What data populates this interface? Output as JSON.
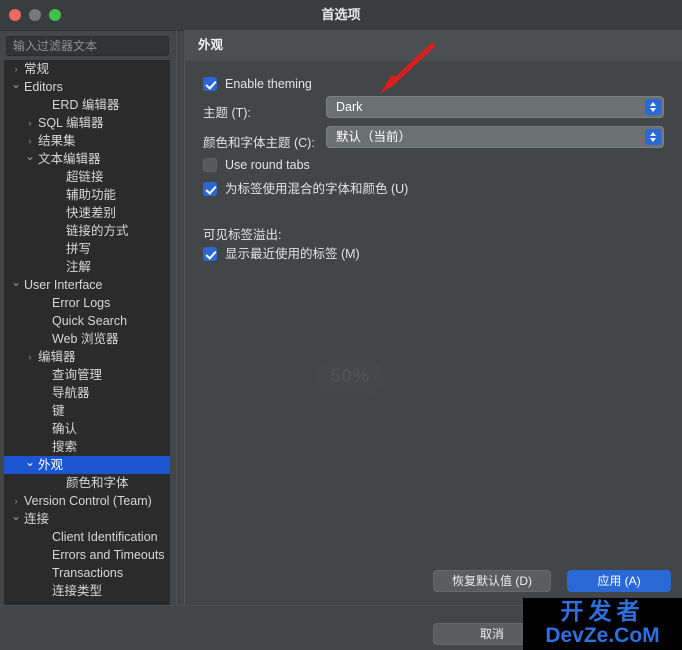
{
  "window": {
    "title": "首选项",
    "traffic_lights": [
      "close-red",
      "minimize-amber",
      "zoom-green"
    ]
  },
  "sidebar": {
    "filter": {
      "value": "",
      "placeholder": "输入过滤器文本"
    },
    "items": [
      {
        "label": "常规",
        "indent": 0,
        "arrow": "collapsed",
        "selected": false
      },
      {
        "label": "Editors",
        "indent": 0,
        "arrow": "expanded",
        "selected": false
      },
      {
        "label": "ERD 编辑器",
        "indent": 2,
        "arrow": "none",
        "selected": false
      },
      {
        "label": "SQL 编辑器",
        "indent": 1,
        "arrow": "collapsed",
        "selected": false
      },
      {
        "label": "结果集",
        "indent": 1,
        "arrow": "collapsed",
        "selected": false
      },
      {
        "label": "文本编辑器",
        "indent": 1,
        "arrow": "expanded",
        "selected": false
      },
      {
        "label": "超链接",
        "indent": 3,
        "arrow": "none",
        "selected": false
      },
      {
        "label": "辅助功能",
        "indent": 3,
        "arrow": "none",
        "selected": false
      },
      {
        "label": "快速差别",
        "indent": 3,
        "arrow": "none",
        "selected": false
      },
      {
        "label": "链接的方式",
        "indent": 3,
        "arrow": "none",
        "selected": false
      },
      {
        "label": "拼写",
        "indent": 3,
        "arrow": "none",
        "selected": false
      },
      {
        "label": "注解",
        "indent": 3,
        "arrow": "none",
        "selected": false
      },
      {
        "label": "User Interface",
        "indent": 0,
        "arrow": "expanded",
        "selected": false
      },
      {
        "label": "Error Logs",
        "indent": 2,
        "arrow": "none",
        "selected": false
      },
      {
        "label": "Quick Search",
        "indent": 2,
        "arrow": "none",
        "selected": false
      },
      {
        "label": "Web 浏览器",
        "indent": 2,
        "arrow": "none",
        "selected": false
      },
      {
        "label": "编辑器",
        "indent": 1,
        "arrow": "collapsed",
        "selected": false
      },
      {
        "label": "查询管理",
        "indent": 2,
        "arrow": "none",
        "selected": false
      },
      {
        "label": "导航器",
        "indent": 2,
        "arrow": "none",
        "selected": false
      },
      {
        "label": "键",
        "indent": 2,
        "arrow": "none",
        "selected": false
      },
      {
        "label": "确认",
        "indent": 2,
        "arrow": "none",
        "selected": false
      },
      {
        "label": "搜索",
        "indent": 2,
        "arrow": "none",
        "selected": false
      },
      {
        "label": "外观",
        "indent": 1,
        "arrow": "expanded",
        "selected": true
      },
      {
        "label": "颜色和字体",
        "indent": 3,
        "arrow": "none",
        "selected": false
      },
      {
        "label": "Version Control (Team)",
        "indent": 0,
        "arrow": "collapsed",
        "selected": false
      },
      {
        "label": "连接",
        "indent": 0,
        "arrow": "expanded",
        "selected": false
      },
      {
        "label": "Client Identification",
        "indent": 2,
        "arrow": "none",
        "selected": false
      },
      {
        "label": "Errors and Timeouts",
        "indent": 2,
        "arrow": "none",
        "selected": false
      },
      {
        "label": "Transactions",
        "indent": 2,
        "arrow": "none",
        "selected": false
      },
      {
        "label": "连接类型",
        "indent": 2,
        "arrow": "none",
        "selected": false
      }
    ]
  },
  "panel": {
    "title": "外观",
    "toolbar": {
      "back_icon": "arrow-left-icon",
      "back_caret": "▾",
      "forward_icon": "arrow-right-icon",
      "forward_caret": "▾",
      "menu_icon": "kebab-menu-icon"
    },
    "enable_theming": {
      "label": "Enable theming",
      "checked": true
    },
    "theme": {
      "label": "主题 (T):",
      "value": "Dark"
    },
    "color_font_theme": {
      "label": "颜色和字体主题 (C):",
      "value": "默认（当前）"
    },
    "use_round_tabs": {
      "label": "Use round tabs",
      "checked": false
    },
    "mixed_fonts": {
      "label": "为标签使用混合的字体和颜色 (U)",
      "checked": true
    },
    "overflow_section": {
      "label": "可见标签溢出:",
      "show_recent": {
        "label": "显示最近使用的标签 (M)",
        "checked": true
      }
    },
    "ghost_badge": "50%"
  },
  "footer": {
    "restore_defaults": "恢复默认值 (D)",
    "apply": "应用 (A)",
    "cancel": "取消"
  },
  "watermark": {
    "top": "开发者",
    "bottom": "DevZe.CoM"
  },
  "colors": {
    "accent_blue": "#2a68d6",
    "selection_blue": "#1b55d1",
    "tree_bg": "#2b2b2b",
    "panel_bg": "#424649",
    "annotation_red": "#d81f1f",
    "back_arrow_orange": "#e8a33d"
  }
}
